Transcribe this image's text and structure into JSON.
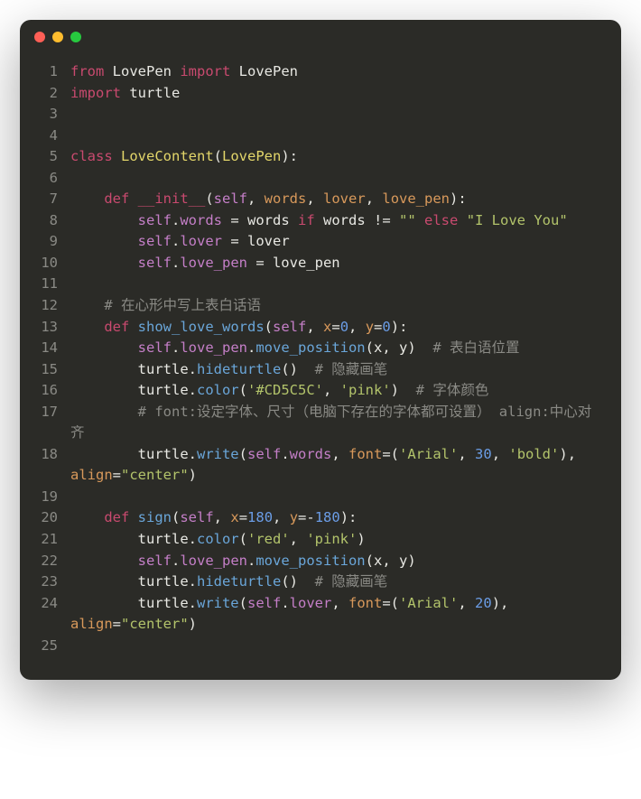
{
  "window": {
    "traffic_lights": [
      "red",
      "yellow",
      "green"
    ]
  },
  "colors": {
    "background": "#2b2b27",
    "red": "#ff5f56",
    "yellow": "#ffbd2e",
    "green": "#27c93f"
  },
  "code": {
    "lines": [
      {
        "no": "1",
        "tokens": [
          [
            "kw",
            "from"
          ],
          [
            "pl",
            " LovePen "
          ],
          [
            "kw",
            "import"
          ],
          [
            "pl",
            " LovePen"
          ]
        ]
      },
      {
        "no": "2",
        "tokens": [
          [
            "kw",
            "import"
          ],
          [
            "pl",
            " turtle"
          ]
        ]
      },
      {
        "no": "3",
        "tokens": []
      },
      {
        "no": "4",
        "tokens": []
      },
      {
        "no": "5",
        "tokens": [
          [
            "kw",
            "class"
          ],
          [
            "pl",
            " "
          ],
          [
            "cls",
            "LoveContent"
          ],
          [
            "op",
            "("
          ],
          [
            "cls",
            "LovePen"
          ],
          [
            "op",
            "):"
          ]
        ]
      },
      {
        "no": "6",
        "tokens": []
      },
      {
        "no": "7",
        "tokens": [
          [
            "pl",
            "    "
          ],
          [
            "kw",
            "def"
          ],
          [
            "pl",
            " "
          ],
          [
            "magic",
            "__init__"
          ],
          [
            "op",
            "("
          ],
          [
            "self",
            "self"
          ],
          [
            "op",
            ", "
          ],
          [
            "param",
            "words"
          ],
          [
            "op",
            ", "
          ],
          [
            "param",
            "lover"
          ],
          [
            "op",
            ", "
          ],
          [
            "param",
            "love_pen"
          ],
          [
            "op",
            "):"
          ]
        ]
      },
      {
        "no": "8",
        "tokens": [
          [
            "pl",
            "        "
          ],
          [
            "self",
            "self"
          ],
          [
            "op",
            "."
          ],
          [
            "attr",
            "words"
          ],
          [
            "op",
            " = words "
          ],
          [
            "kw",
            "if"
          ],
          [
            "op",
            " words != "
          ],
          [
            "str",
            "\"\""
          ],
          [
            "op",
            " "
          ],
          [
            "kw",
            "else"
          ],
          [
            "op",
            " "
          ],
          [
            "str",
            "\"I Love You\""
          ]
        ]
      },
      {
        "no": "9",
        "tokens": [
          [
            "pl",
            "        "
          ],
          [
            "self",
            "self"
          ],
          [
            "op",
            "."
          ],
          [
            "attr",
            "lover"
          ],
          [
            "op",
            " = lover"
          ]
        ]
      },
      {
        "no": "10",
        "tokens": [
          [
            "pl",
            "        "
          ],
          [
            "self",
            "self"
          ],
          [
            "op",
            "."
          ],
          [
            "attr",
            "love_pen"
          ],
          [
            "op",
            " = love_pen"
          ]
        ]
      },
      {
        "no": "11",
        "tokens": []
      },
      {
        "no": "12",
        "tokens": [
          [
            "pl",
            "    "
          ],
          [
            "cmt",
            "# 在心形中写上表白话语"
          ]
        ]
      },
      {
        "no": "13",
        "tokens": [
          [
            "pl",
            "    "
          ],
          [
            "kw",
            "def"
          ],
          [
            "pl",
            " "
          ],
          [
            "fn",
            "show_love_words"
          ],
          [
            "op",
            "("
          ],
          [
            "self",
            "self"
          ],
          [
            "op",
            ", "
          ],
          [
            "param",
            "x"
          ],
          [
            "op",
            "="
          ],
          [
            "num",
            "0"
          ],
          [
            "op",
            ", "
          ],
          [
            "param",
            "y"
          ],
          [
            "op",
            "="
          ],
          [
            "num",
            "0"
          ],
          [
            "op",
            "):"
          ]
        ]
      },
      {
        "no": "14",
        "tokens": [
          [
            "pl",
            "        "
          ],
          [
            "self",
            "self"
          ],
          [
            "op",
            "."
          ],
          [
            "attr",
            "love_pen"
          ],
          [
            "op",
            "."
          ],
          [
            "fn",
            "move_position"
          ],
          [
            "op",
            "(x, y)  "
          ],
          [
            "cmt",
            "# 表白语位置"
          ]
        ]
      },
      {
        "no": "15",
        "tokens": [
          [
            "pl",
            "        turtle."
          ],
          [
            "fn",
            "hideturtle"
          ],
          [
            "op",
            "()  "
          ],
          [
            "cmt",
            "# 隐藏画笔"
          ]
        ]
      },
      {
        "no": "16",
        "tokens": [
          [
            "pl",
            "        turtle."
          ],
          [
            "fn",
            "color"
          ],
          [
            "op",
            "("
          ],
          [
            "str",
            "'#CD5C5C'"
          ],
          [
            "op",
            ", "
          ],
          [
            "str",
            "'pink'"
          ],
          [
            "op",
            ")  "
          ],
          [
            "cmt",
            "# 字体颜色"
          ]
        ]
      },
      {
        "no": "17",
        "tokens": [
          [
            "pl",
            "        "
          ],
          [
            "cmt",
            "# font:设定字体、尺寸（电脑下存在的字体都可设置） align:中心对齐"
          ]
        ]
      },
      {
        "no": "18",
        "tokens": [
          [
            "pl",
            "        turtle."
          ],
          [
            "fn",
            "write"
          ],
          [
            "op",
            "("
          ],
          [
            "self",
            "self"
          ],
          [
            "op",
            "."
          ],
          [
            "attr",
            "words"
          ],
          [
            "op",
            ", "
          ],
          [
            "param",
            "font"
          ],
          [
            "op",
            "=("
          ],
          [
            "str",
            "'Arial'"
          ],
          [
            "op",
            ", "
          ],
          [
            "num",
            "30"
          ],
          [
            "op",
            ", "
          ],
          [
            "str",
            "'bold'"
          ],
          [
            "op",
            "), "
          ],
          [
            "param",
            "align"
          ],
          [
            "op",
            "="
          ],
          [
            "str",
            "\"center\""
          ],
          [
            "op",
            ")"
          ]
        ]
      },
      {
        "no": "19",
        "tokens": []
      },
      {
        "no": "20",
        "tokens": [
          [
            "pl",
            "    "
          ],
          [
            "kw",
            "def"
          ],
          [
            "pl",
            " "
          ],
          [
            "fn",
            "sign"
          ],
          [
            "op",
            "("
          ],
          [
            "self",
            "self"
          ],
          [
            "op",
            ", "
          ],
          [
            "param",
            "x"
          ],
          [
            "op",
            "="
          ],
          [
            "num",
            "180"
          ],
          [
            "op",
            ", "
          ],
          [
            "param",
            "y"
          ],
          [
            "op",
            "=-"
          ],
          [
            "num",
            "180"
          ],
          [
            "op",
            "):"
          ]
        ]
      },
      {
        "no": "21",
        "tokens": [
          [
            "pl",
            "        turtle."
          ],
          [
            "fn",
            "color"
          ],
          [
            "op",
            "("
          ],
          [
            "str",
            "'red'"
          ],
          [
            "op",
            ", "
          ],
          [
            "str",
            "'pink'"
          ],
          [
            "op",
            ")"
          ]
        ]
      },
      {
        "no": "22",
        "tokens": [
          [
            "pl",
            "        "
          ],
          [
            "self",
            "self"
          ],
          [
            "op",
            "."
          ],
          [
            "attr",
            "love_pen"
          ],
          [
            "op",
            "."
          ],
          [
            "fn",
            "move_position"
          ],
          [
            "op",
            "(x, y)"
          ]
        ]
      },
      {
        "no": "23",
        "tokens": [
          [
            "pl",
            "        turtle."
          ],
          [
            "fn",
            "hideturtle"
          ],
          [
            "op",
            "()  "
          ],
          [
            "cmt",
            "# 隐藏画笔"
          ]
        ]
      },
      {
        "no": "24",
        "tokens": [
          [
            "pl",
            "        turtle."
          ],
          [
            "fn",
            "write"
          ],
          [
            "op",
            "("
          ],
          [
            "self",
            "self"
          ],
          [
            "op",
            "."
          ],
          [
            "attr",
            "lover"
          ],
          [
            "op",
            ", "
          ],
          [
            "param",
            "font"
          ],
          [
            "op",
            "=("
          ],
          [
            "str",
            "'Arial'"
          ],
          [
            "op",
            ", "
          ],
          [
            "num",
            "20"
          ],
          [
            "op",
            "), "
          ],
          [
            "param",
            "align"
          ],
          [
            "op",
            "="
          ],
          [
            "str",
            "\"center\""
          ],
          [
            "op",
            ")"
          ]
        ]
      },
      {
        "no": "25",
        "tokens": []
      }
    ]
  }
}
